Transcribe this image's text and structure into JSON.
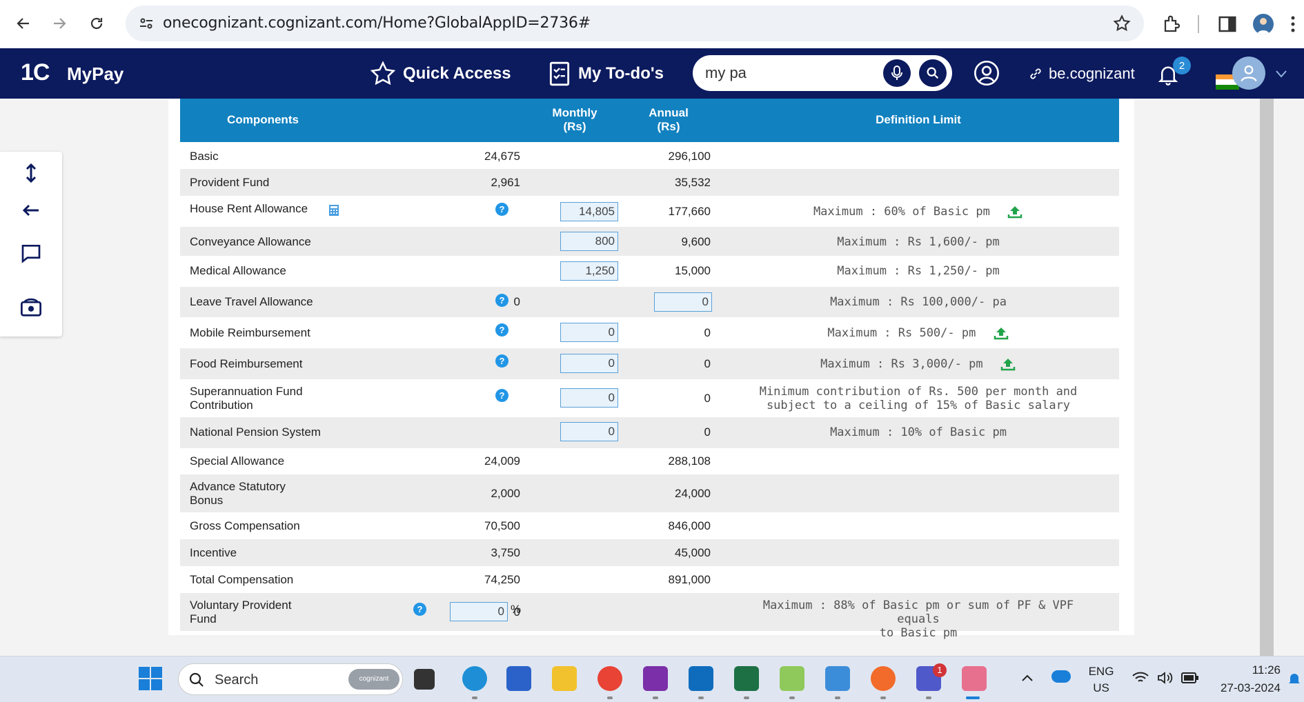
{
  "browser": {
    "url": "onecognizant.cognizant.com/Home?GlobalAppID=2736#"
  },
  "header": {
    "logo": "1C",
    "app_name": "MyPay",
    "quick_access": "Quick Access",
    "todos": "My To-do's",
    "search_value": "my pa",
    "be_link": "be.cognizant",
    "notification_count": "2"
  },
  "table": {
    "headers": {
      "components": "Components",
      "monthly_1": "Monthly",
      "monthly_2": "(Rs)",
      "annual_1": "Annual",
      "annual_2": "(Rs)",
      "definition": "Definition Limit"
    },
    "rows": [
      {
        "component": "Basic",
        "monthly": "24,675",
        "annual": "296,100",
        "definition": ""
      },
      {
        "component": "Provident Fund",
        "monthly": "2,961",
        "annual": "35,532",
        "definition": ""
      },
      {
        "component": "House Rent Allowance",
        "monthly": "14,805",
        "annual": "177,660",
        "definition": "Maximum : 60% of Basic pm"
      },
      {
        "component": "Conveyance Allowance",
        "monthly": "800",
        "annual": "9,600",
        "definition": "Maximum : Rs 1,600/- pm"
      },
      {
        "component": "Medical Allowance",
        "monthly": "1,250",
        "annual": "15,000",
        "definition": "Maximum : Rs 1,250/- pm"
      },
      {
        "component": "Leave Travel Allowance",
        "monthly": "0",
        "annual": "0",
        "definition": "Maximum : Rs 100,000/- pa"
      },
      {
        "component": "Mobile Reimbursement",
        "monthly": "0",
        "annual": "0",
        "definition": "Maximum : Rs 500/- pm"
      },
      {
        "component": "Food Reimbursement",
        "monthly": "0",
        "annual": "0",
        "definition": "Maximum : Rs 3,000/- pm"
      },
      {
        "component": "Superannuation Fund",
        "component_2": "Contribution",
        "monthly": "0",
        "annual": "0",
        "definition": "Minimum contribution of Rs. 500 per month and",
        "definition_2": "subject to a ceiling of 15% of Basic salary"
      },
      {
        "component": "National Pension System",
        "monthly": "0",
        "annual": "0",
        "definition": "Maximum : 10% of Basic pm"
      },
      {
        "component": "Special Allowance",
        "monthly": "24,009",
        "annual": "288,108",
        "definition": ""
      },
      {
        "component": "Advance Statutory",
        "component_2": "Bonus",
        "monthly": "2,000",
        "annual": "24,000",
        "definition": ""
      },
      {
        "component": "Gross Compensation",
        "monthly": "70,500",
        "annual": "846,000",
        "definition": ""
      },
      {
        "component": "Incentive",
        "monthly": "3,750",
        "annual": "45,000",
        "definition": ""
      },
      {
        "component": "Total Compensation",
        "monthly": "74,250",
        "annual": "891,000",
        "definition": ""
      },
      {
        "component": "Voluntary Provident",
        "component_2": "Fund",
        "percent_value": "0",
        "percent_sign": "%",
        "monthly": "0",
        "annual": "",
        "definition": "Maximum : 88% of Basic pm or sum of PF & VPF equals",
        "definition_2": "to Basic pm"
      }
    ]
  },
  "taskbar": {
    "search_placeholder": "Search",
    "search_badge": "cognizant",
    "lang_1": "ENG",
    "lang_2": "US",
    "time": "11:26",
    "date": "27-03-2024",
    "teams_badge": "1"
  },
  "colors": {
    "header_bg": "#0c1a5e",
    "table_header_bg": "#1181c0",
    "input_bg": "#e7f2fb"
  }
}
